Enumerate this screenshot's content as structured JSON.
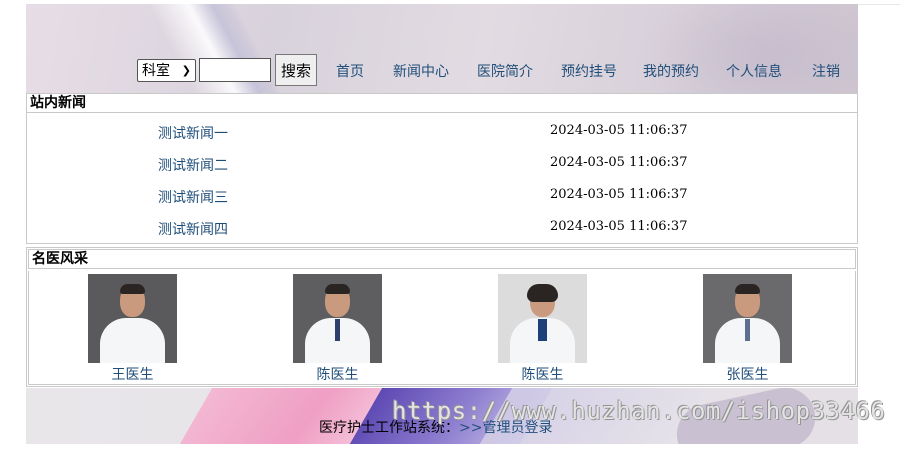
{
  "search": {
    "department_selected": "科室",
    "keyword_value": "",
    "button_label": "搜索"
  },
  "nav": {
    "items": [
      "首页",
      "新闻中心",
      "医院简介",
      "预约挂号",
      "我的预约",
      "个人信息",
      "注销"
    ]
  },
  "news": {
    "section_title": "站内新闻",
    "rows": [
      {
        "title": "测试新闻一",
        "time": "2024-03-05 11:06:37"
      },
      {
        "title": "测试新闻二",
        "time": "2024-03-05 11:06:37"
      },
      {
        "title": "测试新闻三",
        "time": "2024-03-05 11:06:37"
      },
      {
        "title": "测试新闻四",
        "time": "2024-03-05 11:06:37"
      }
    ]
  },
  "doctors": {
    "section_title": "名医风采",
    "items": [
      {
        "name": "王医生",
        "photo_bg": "#5a5a5c"
      },
      {
        "name": "陈医生",
        "photo_bg": "#5e5e60"
      },
      {
        "name": "陈医生",
        "photo_bg": "#dcdcdc"
      },
      {
        "name": "张医生",
        "photo_bg": "#6a6a6c"
      }
    ]
  },
  "footer": {
    "text": "医疗护士工作站系统：",
    "admin_link": ">>管理员登录"
  },
  "watermark": "https://www.huzhan.com/ishop33466",
  "colors": {
    "link": "#1f4e79",
    "border": "#c9c9c9"
  }
}
